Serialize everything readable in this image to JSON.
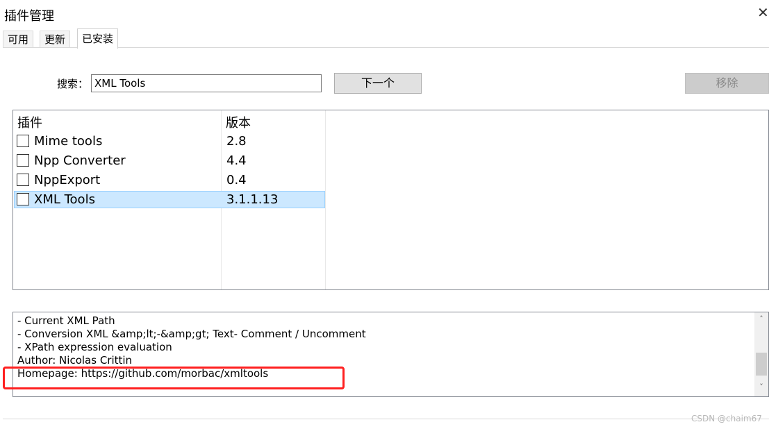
{
  "window": {
    "title": "插件管理",
    "close_glyph": "✕"
  },
  "tabs": [
    {
      "label": "可用"
    },
    {
      "label": "更新"
    },
    {
      "label": "已安装",
      "active": true
    }
  ],
  "search": {
    "label": "搜索：",
    "value": "XML Tools"
  },
  "buttons": {
    "next_label": "下一个",
    "remove_label": "移除"
  },
  "plugin_list": {
    "headers": {
      "name": "插件",
      "version": "版本"
    },
    "rows": [
      {
        "name": "Mime tools",
        "version": "2.8",
        "checked": false
      },
      {
        "name": "Npp Converter",
        "version": "4.4",
        "checked": false
      },
      {
        "name": "NppExport",
        "version": "0.4",
        "checked": false
      },
      {
        "name": "XML Tools",
        "version": "3.1.1.13",
        "checked": false,
        "selected": true
      }
    ]
  },
  "description": {
    "lines": [
      "- Current XML Path",
      "- Conversion XML &amp;lt;-&amp;gt; Text- Comment / Uncomment",
      "- XPath expression evaluation",
      "Author: Nicolas Crittin",
      "Homepage: https://github.com/morbac/xmltools"
    ]
  },
  "scrollbar": {
    "up_icon": "˄",
    "down_icon": "˅"
  },
  "colors": {
    "selection_bg": "#cce8ff",
    "highlight_border": "#ff2020"
  },
  "watermark": "CSDN @chaim67"
}
